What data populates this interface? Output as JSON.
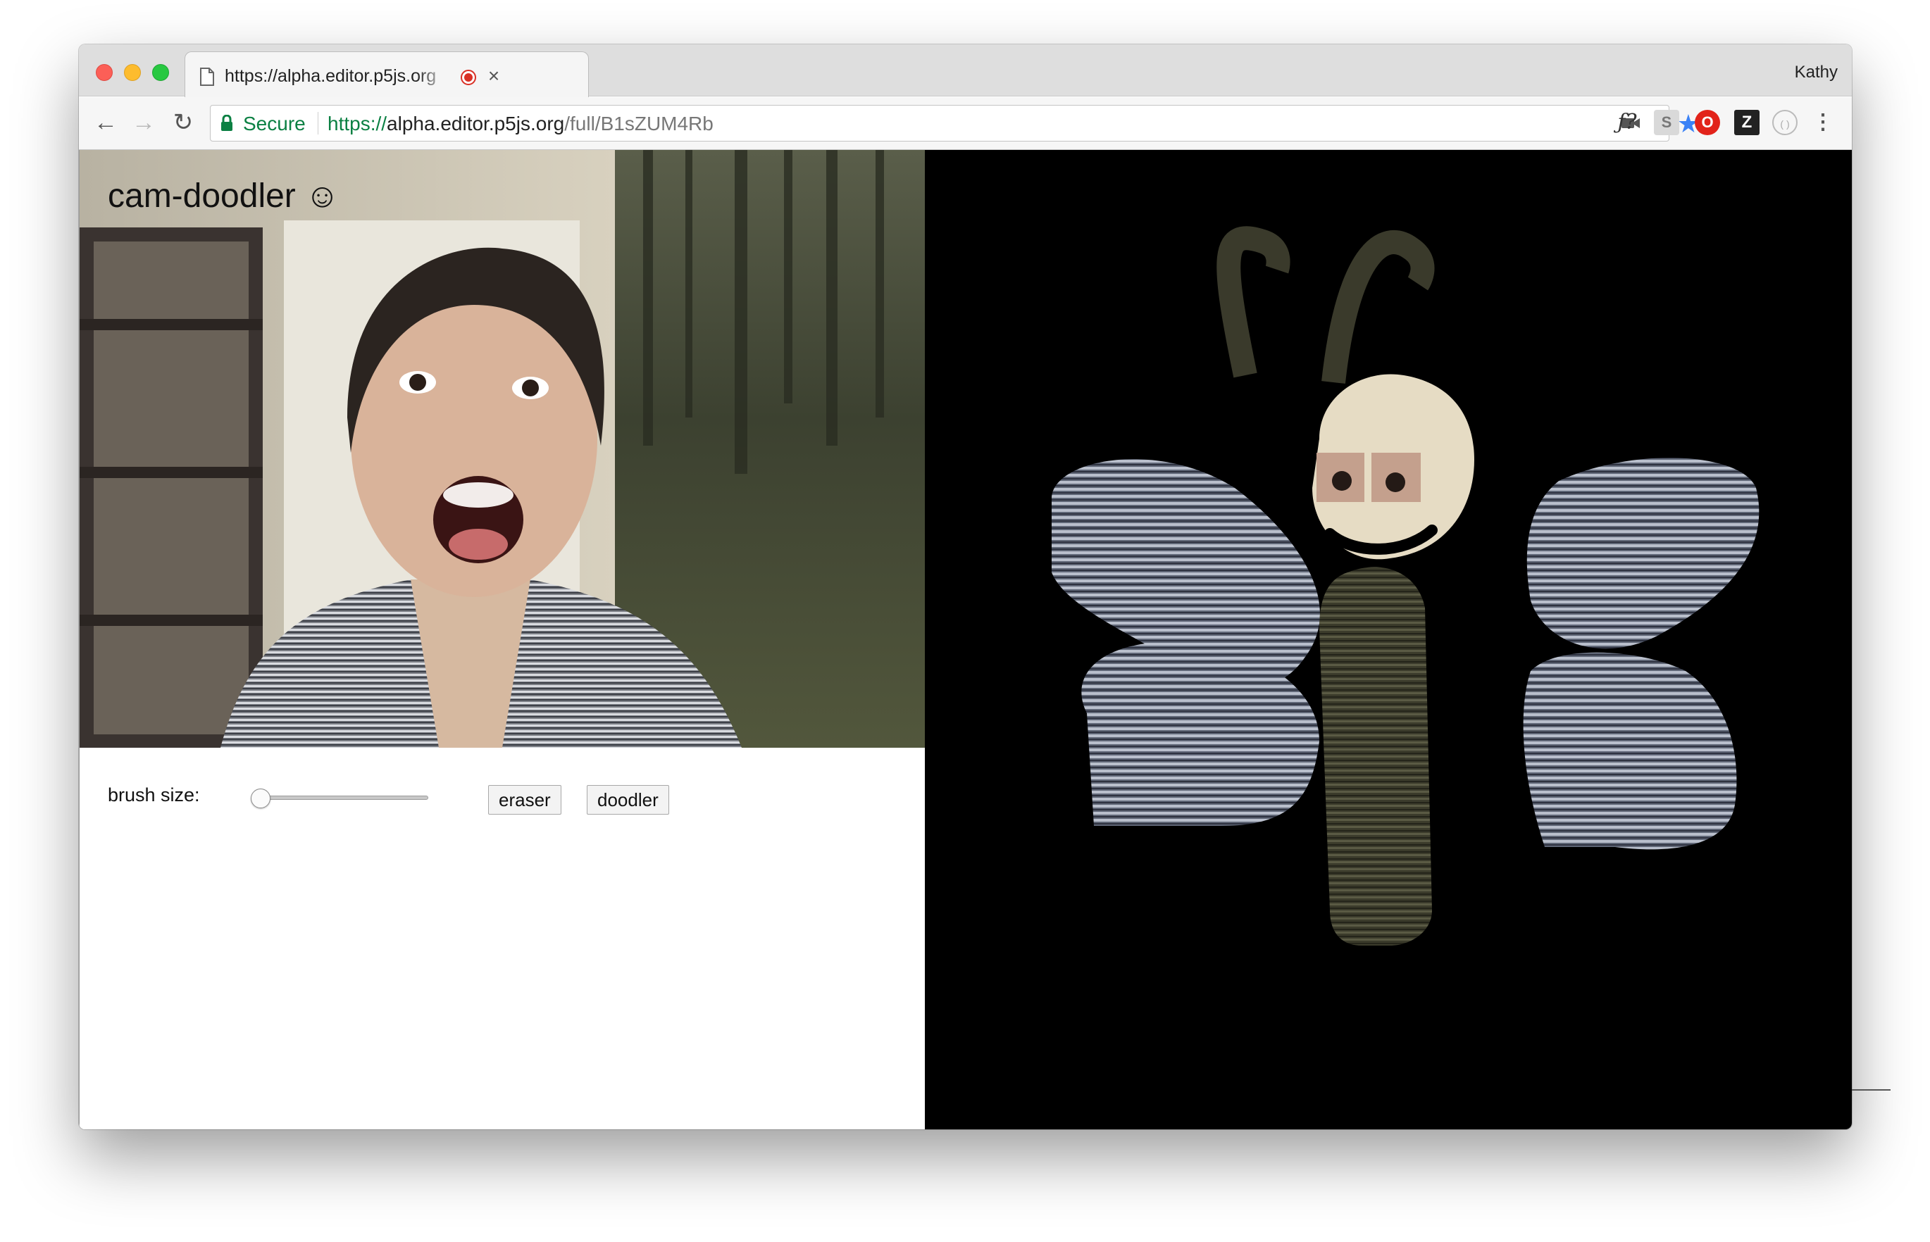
{
  "browser": {
    "tab": {
      "title": "https://alpha.editor.p5js.org",
      "close_icon": "close-icon",
      "recording_icon": "recording-icon"
    },
    "profile_name": "Kathy",
    "toolbar": {
      "back_icon": "back-arrow-icon",
      "forward_icon": "forward-arrow-icon",
      "reload_icon": "reload-icon",
      "secure_label": "Secure",
      "url_scheme": "https://",
      "url_host": "alpha.editor.p5js.org",
      "url_path": "/full/B1sZUM4Rb",
      "extensions": [
        {
          "icon": "f-question-icon",
          "label": "ƒ?"
        },
        {
          "icon": "s-extension-icon",
          "label": "S"
        },
        {
          "icon": "opera-icon",
          "label": "O"
        },
        {
          "icon": "z-extension-icon",
          "label": "Z"
        },
        {
          "icon": "circle-extension-icon",
          "label": "( )"
        },
        {
          "icon": "menu-icon",
          "label": "⋮"
        }
      ]
    }
  },
  "app": {
    "title": "cam-doodler ☺",
    "brush_label": "brush size:",
    "brush_size_fraction": 0.0,
    "buttons": {
      "eraser": "eraser",
      "doodler": "doodler"
    }
  },
  "colors": {
    "secure_green": "#0b8043",
    "star_blue": "#3b82f6",
    "canvas_bg": "#000000",
    "wing_gray": "#7d8596",
    "body_olive": "#3f3f2e"
  }
}
